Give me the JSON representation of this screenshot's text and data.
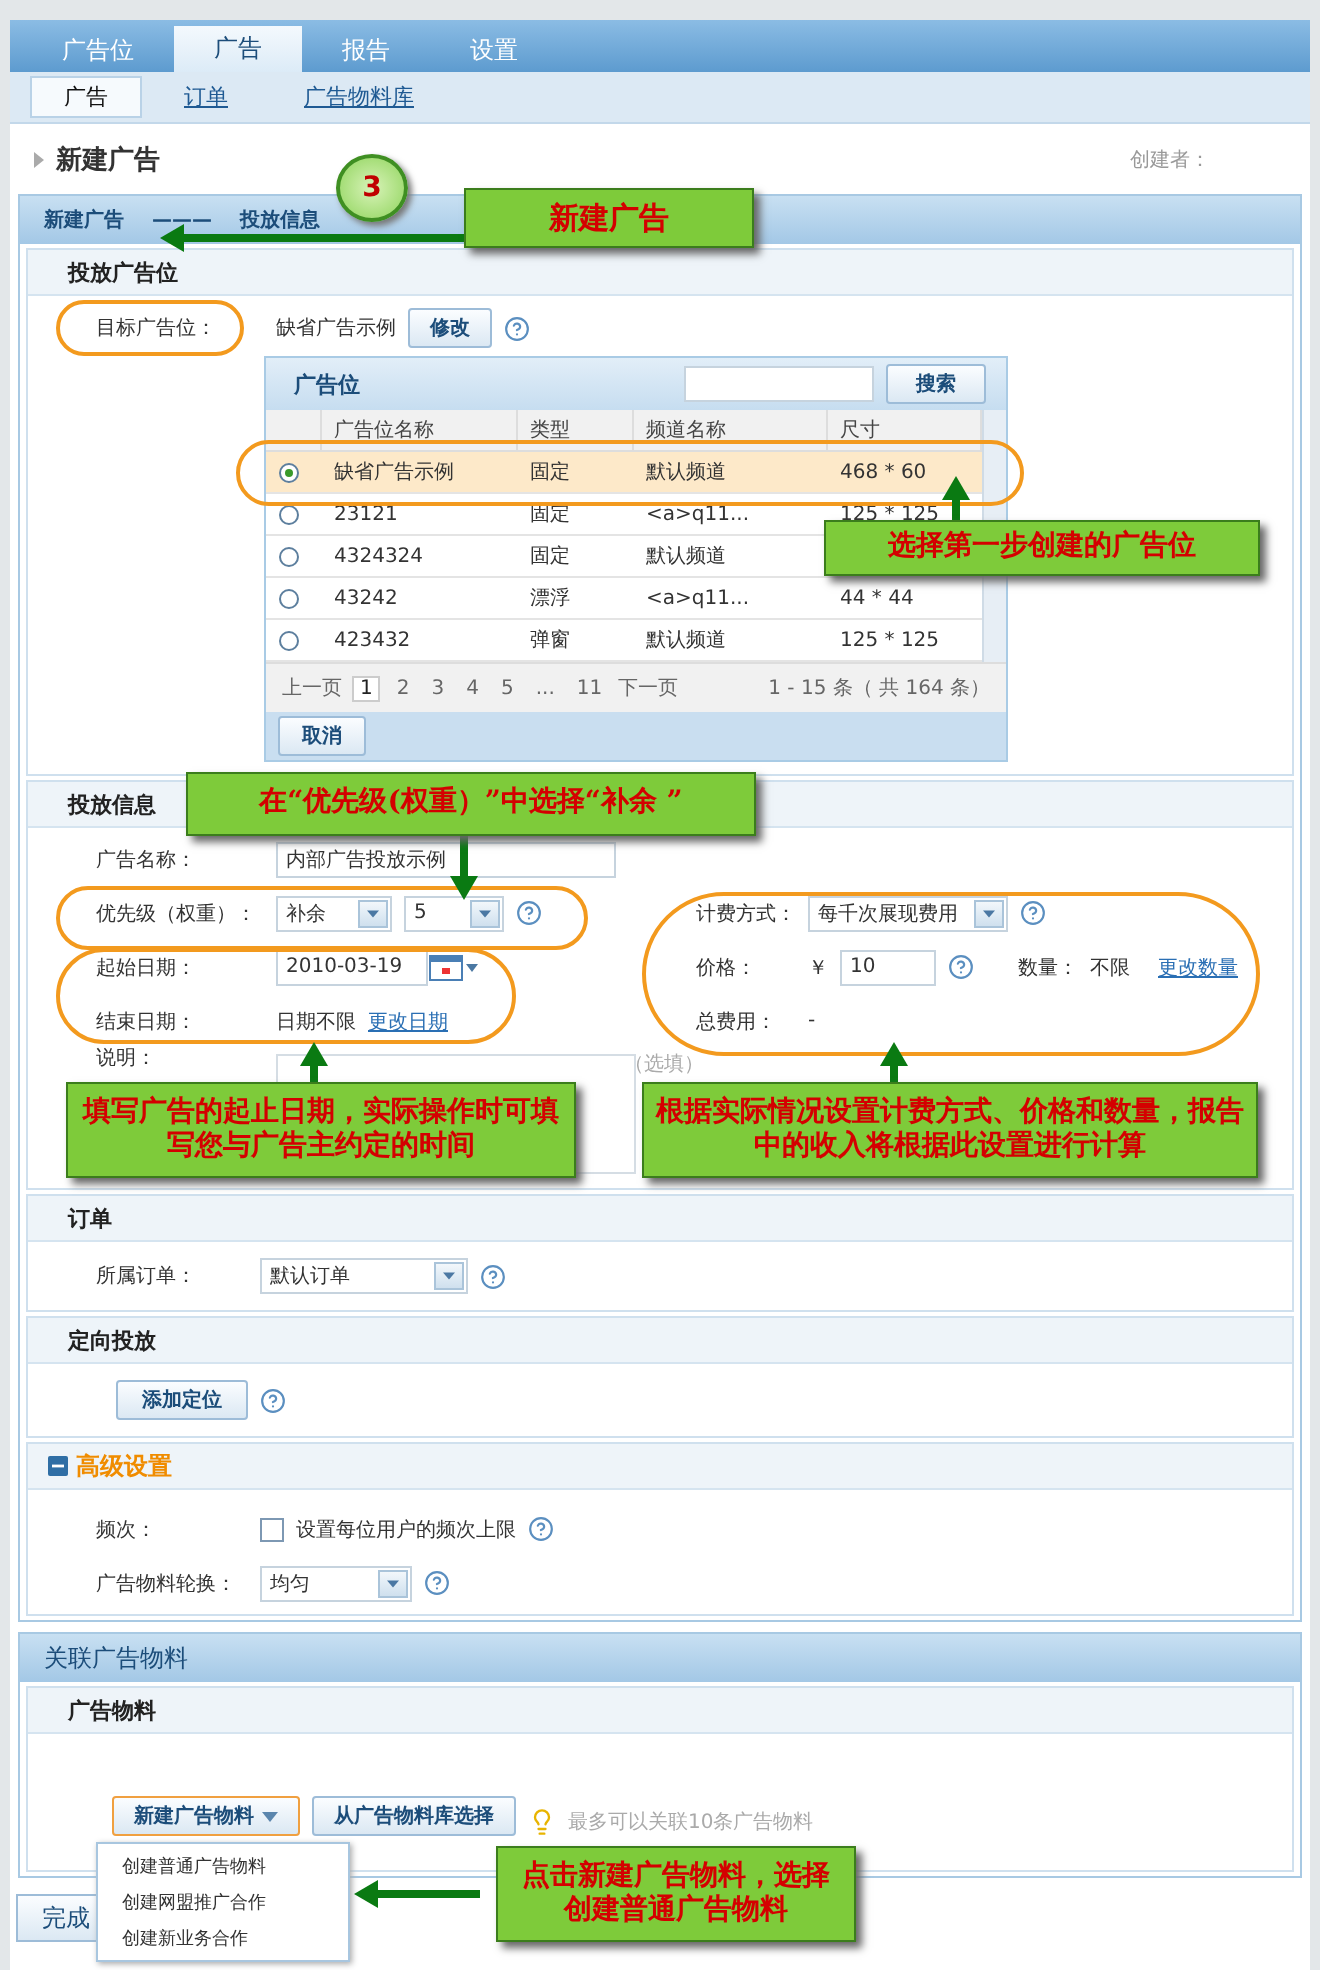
{
  "tabs": [
    {
      "label": "广告位",
      "selected": false
    },
    {
      "label": "广告",
      "selected": true
    },
    {
      "label": "报告",
      "selected": false
    },
    {
      "label": "设置",
      "selected": false
    }
  ],
  "subnav": [
    {
      "label": "广告",
      "selected": true
    },
    {
      "label": "订单",
      "selected": false
    },
    {
      "label": "广告物料库",
      "selected": false
    }
  ],
  "page_title": "新建广告",
  "creator_label": "创建者：",
  "steps": [
    "新建广告",
    "———",
    "投放信息"
  ],
  "placement": {
    "title": "投放广告位",
    "target_label": "目标广告位：",
    "target_value": "缺省广告示例",
    "edit_button": "修改",
    "picker": {
      "title": "广告位",
      "search_button": "搜索",
      "columns": [
        "广告位名称",
        "类型",
        "频道名称",
        "尺寸"
      ],
      "rows": [
        {
          "selected": true,
          "cells": [
            "缺省广告示例",
            "固定",
            "默认频道",
            "468 * 60"
          ]
        },
        {
          "selected": false,
          "cells": [
            "23121",
            "固定",
            "<a>q11...",
            "125 * 125"
          ]
        },
        {
          "selected": false,
          "cells": [
            "4324324",
            "固定",
            "默认频道",
            ""
          ]
        },
        {
          "selected": false,
          "cells": [
            "43242",
            "漂浮",
            "<a>q11...",
            "44 * 44"
          ]
        },
        {
          "selected": false,
          "cells": [
            "423432",
            "弹窗",
            "默认频道",
            "125 * 125"
          ]
        }
      ],
      "prev": "上一页",
      "pages": [
        {
          "label": "1",
          "selected": true
        },
        {
          "label": "2",
          "selected": false
        },
        {
          "label": "3",
          "selected": false
        },
        {
          "label": "4",
          "selected": false
        },
        {
          "label": "5",
          "selected": false
        },
        {
          "label": "...",
          "selected": false
        },
        {
          "label": "11",
          "selected": false
        }
      ],
      "next": "下一页",
      "summary": "1 - 15 条（ 共 164 条）",
      "cancel_button": "取消"
    }
  },
  "delivery": {
    "title": "投放信息",
    "name_label": "广告名称：",
    "name_value": "内部广告投放示例",
    "priority_label": "优先级（权重）：",
    "priority_value": "补余",
    "weight_value": "5",
    "start_label": "起始日期：",
    "start_value": "2010-03-19",
    "end_label": "结束日期：",
    "end_value": "日期不限",
    "end_link": "更改日期",
    "note_label": "说明：",
    "note_hint": "（选填）",
    "billing_label": "计费方式：",
    "billing_value": "每千次展现费用",
    "price_label": "价格：",
    "currency": "￥",
    "price_value": "10",
    "quantity_label": "数量：",
    "quantity_value": "不限",
    "quantity_link": "更改数量",
    "total_label": "总费用：",
    "total_value": "-"
  },
  "order": {
    "title": "订单",
    "label": "所属订单：",
    "value": "默认订单"
  },
  "targeting": {
    "title": "定向投放",
    "button": "添加定位"
  },
  "advanced": {
    "title": "高级设置",
    "expanded": true,
    "frequency_label": "频次：",
    "frequency_checkbox": "设置每位用户的频次上限",
    "frequency_checked": false,
    "rotation_label": "广告物料轮换：",
    "rotation_value": "均匀"
  },
  "creatives": {
    "panel_title": "关联广告物料",
    "title": "广告物料",
    "new_button": "新建广告物料",
    "library_button": "从广告物料库选择",
    "tip": "最多可以关联10条广告物料",
    "menu": [
      "创建普通广告物料",
      "创建网盟推广合作",
      "创建新业务合作"
    ]
  },
  "finish_button": "完成",
  "annotations": [
    {
      "kind": "step_badge",
      "text": "3"
    },
    {
      "kind": "callout",
      "text": "新建广告"
    },
    {
      "kind": "callout",
      "text": "选择第一步创建的广告位"
    },
    {
      "kind": "callout",
      "text": "在“优先级(权重）”中选择“补余 ”"
    },
    {
      "kind": "callout",
      "text": "填写广告的起止日期，实际操作时可填写您与广告主约定的时间"
    },
    {
      "kind": "callout",
      "text": "根据实际情况设置计费方式、价格和数量，报告中的收入将根据此设置进行计算"
    },
    {
      "kind": "callout",
      "text": "点击新建广告物料，选择创建普通广告物料"
    }
  ]
}
